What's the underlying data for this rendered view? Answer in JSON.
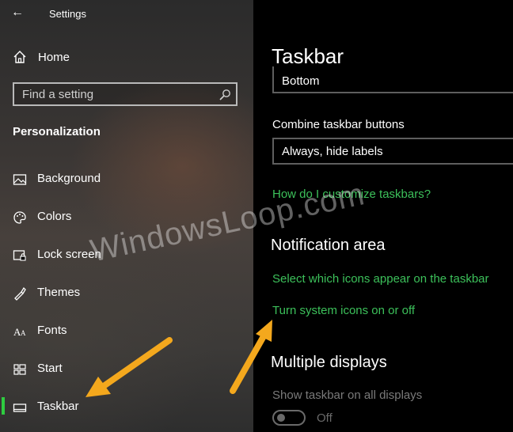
{
  "window": {
    "title": "Settings"
  },
  "sidebar": {
    "home_label": "Home",
    "search_placeholder": "Find a setting",
    "section_title": "Personalization",
    "items": [
      {
        "label": "Background",
        "icon": "image-icon"
      },
      {
        "label": "Colors",
        "icon": "palette-icon"
      },
      {
        "label": "Lock screen",
        "icon": "lock-screen-icon"
      },
      {
        "label": "Themes",
        "icon": "themes-icon"
      },
      {
        "label": "Fonts",
        "icon": "fonts-icon"
      },
      {
        "label": "Start",
        "icon": "start-icon"
      },
      {
        "label": "Taskbar",
        "icon": "taskbar-icon",
        "active": true
      }
    ]
  },
  "main": {
    "title": "Taskbar",
    "taskbar_location_value": "Bottom",
    "combine_label": "Combine taskbar buttons",
    "combine_value": "Always, hide labels",
    "customize_link": "How do I customize taskbars?",
    "notification_heading": "Notification area",
    "select_icons_link": "Select which icons appear on the taskbar",
    "system_icons_link": "Turn system icons on or off",
    "multiple_displays_heading": "Multiple displays",
    "show_all_displays_label": "Show taskbar on all displays",
    "show_all_displays_state": "Off"
  },
  "overlay": {
    "watermark": "WindowsLoop.com"
  },
  "colors": {
    "accent": "#3cc05a",
    "arrow": "#f4a81d",
    "active_indicator": "#2ecc40"
  }
}
